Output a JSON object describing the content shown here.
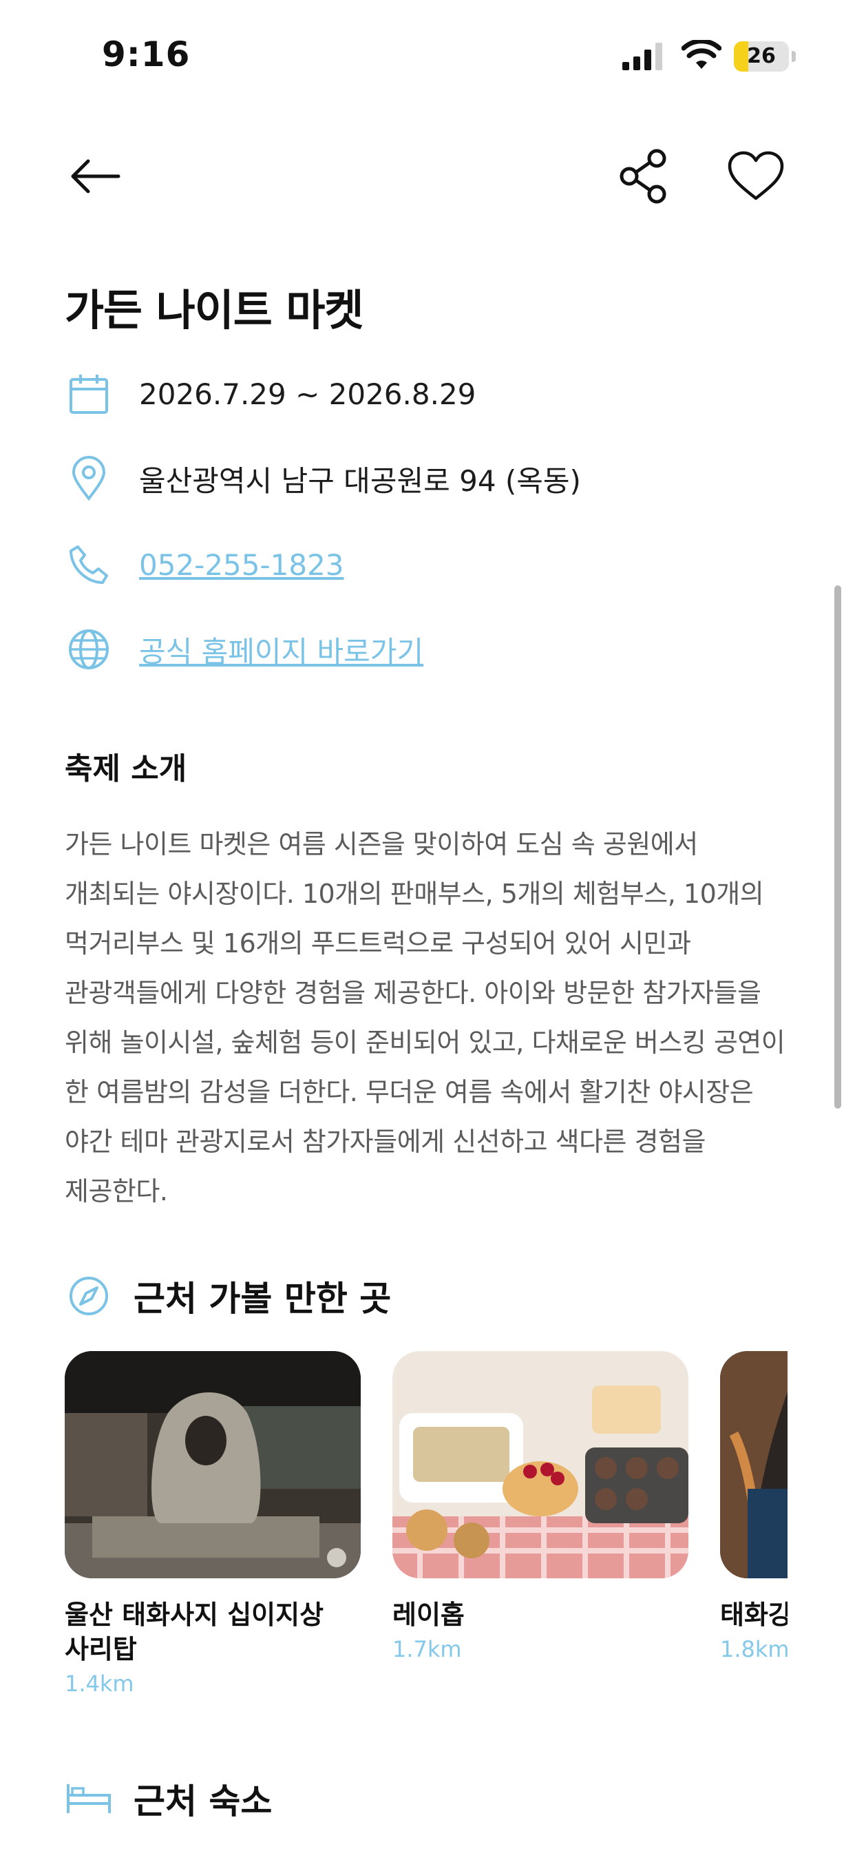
{
  "status_bar": {
    "time": "9:16",
    "battery": "26",
    "battery_level": 0.26
  },
  "page": {
    "title": "가든 나이트 마켓",
    "date_range": "2026.7.29 ~ 2026.8.29",
    "address": "울산광역시 남구 대공원로 94 (옥동)",
    "phone": "052-255-1823",
    "homepage_link": "공식 홈페이지 바로가기"
  },
  "intro": {
    "heading": "축제 소개",
    "body": "가든 나이트 마켓은 여름 시즌을 맞이하여 도심 속 공원에서 개최되는 야시장이다. 10개의 판매부스, 5개의 체험부스, 10개의 먹거리부스 및 16개의 푸드트럭으로 구성되어 있어 시민과 관광객들에게 다양한 경험을 제공한다. 아이와 방문한 참가자들을 위해 놀이시설, 숲체험 등이 준비되어 있고, 다채로운 버스킹 공연이 한 여름밤의 감성을 더한다. 무더운 여름 속에서 활기찬 야시장은 야간 테마 관광지로서 참가자들에게 신선하고 색다른 경험을 제공한다."
  },
  "nearby": {
    "heading": "근처 가볼 만한 곳",
    "places": [
      {
        "name": "울산 태화사지 십이지상 사리탑",
        "distance": "1.4km"
      },
      {
        "name": "레이홉",
        "distance": "1.7km"
      },
      {
        "name": "태화강",
        "distance": "1.8km"
      }
    ]
  },
  "lodging": {
    "heading": "근처 숙소"
  },
  "colors": {
    "accent": "#7ac3e6",
    "distance": "#84c8ea",
    "body_text": "#5b5b5b"
  },
  "icons": [
    "back-arrow-icon",
    "share-icon",
    "heart-icon",
    "calendar-icon",
    "location-pin-icon",
    "phone-icon",
    "globe-icon",
    "compass-icon",
    "bed-icon"
  ]
}
